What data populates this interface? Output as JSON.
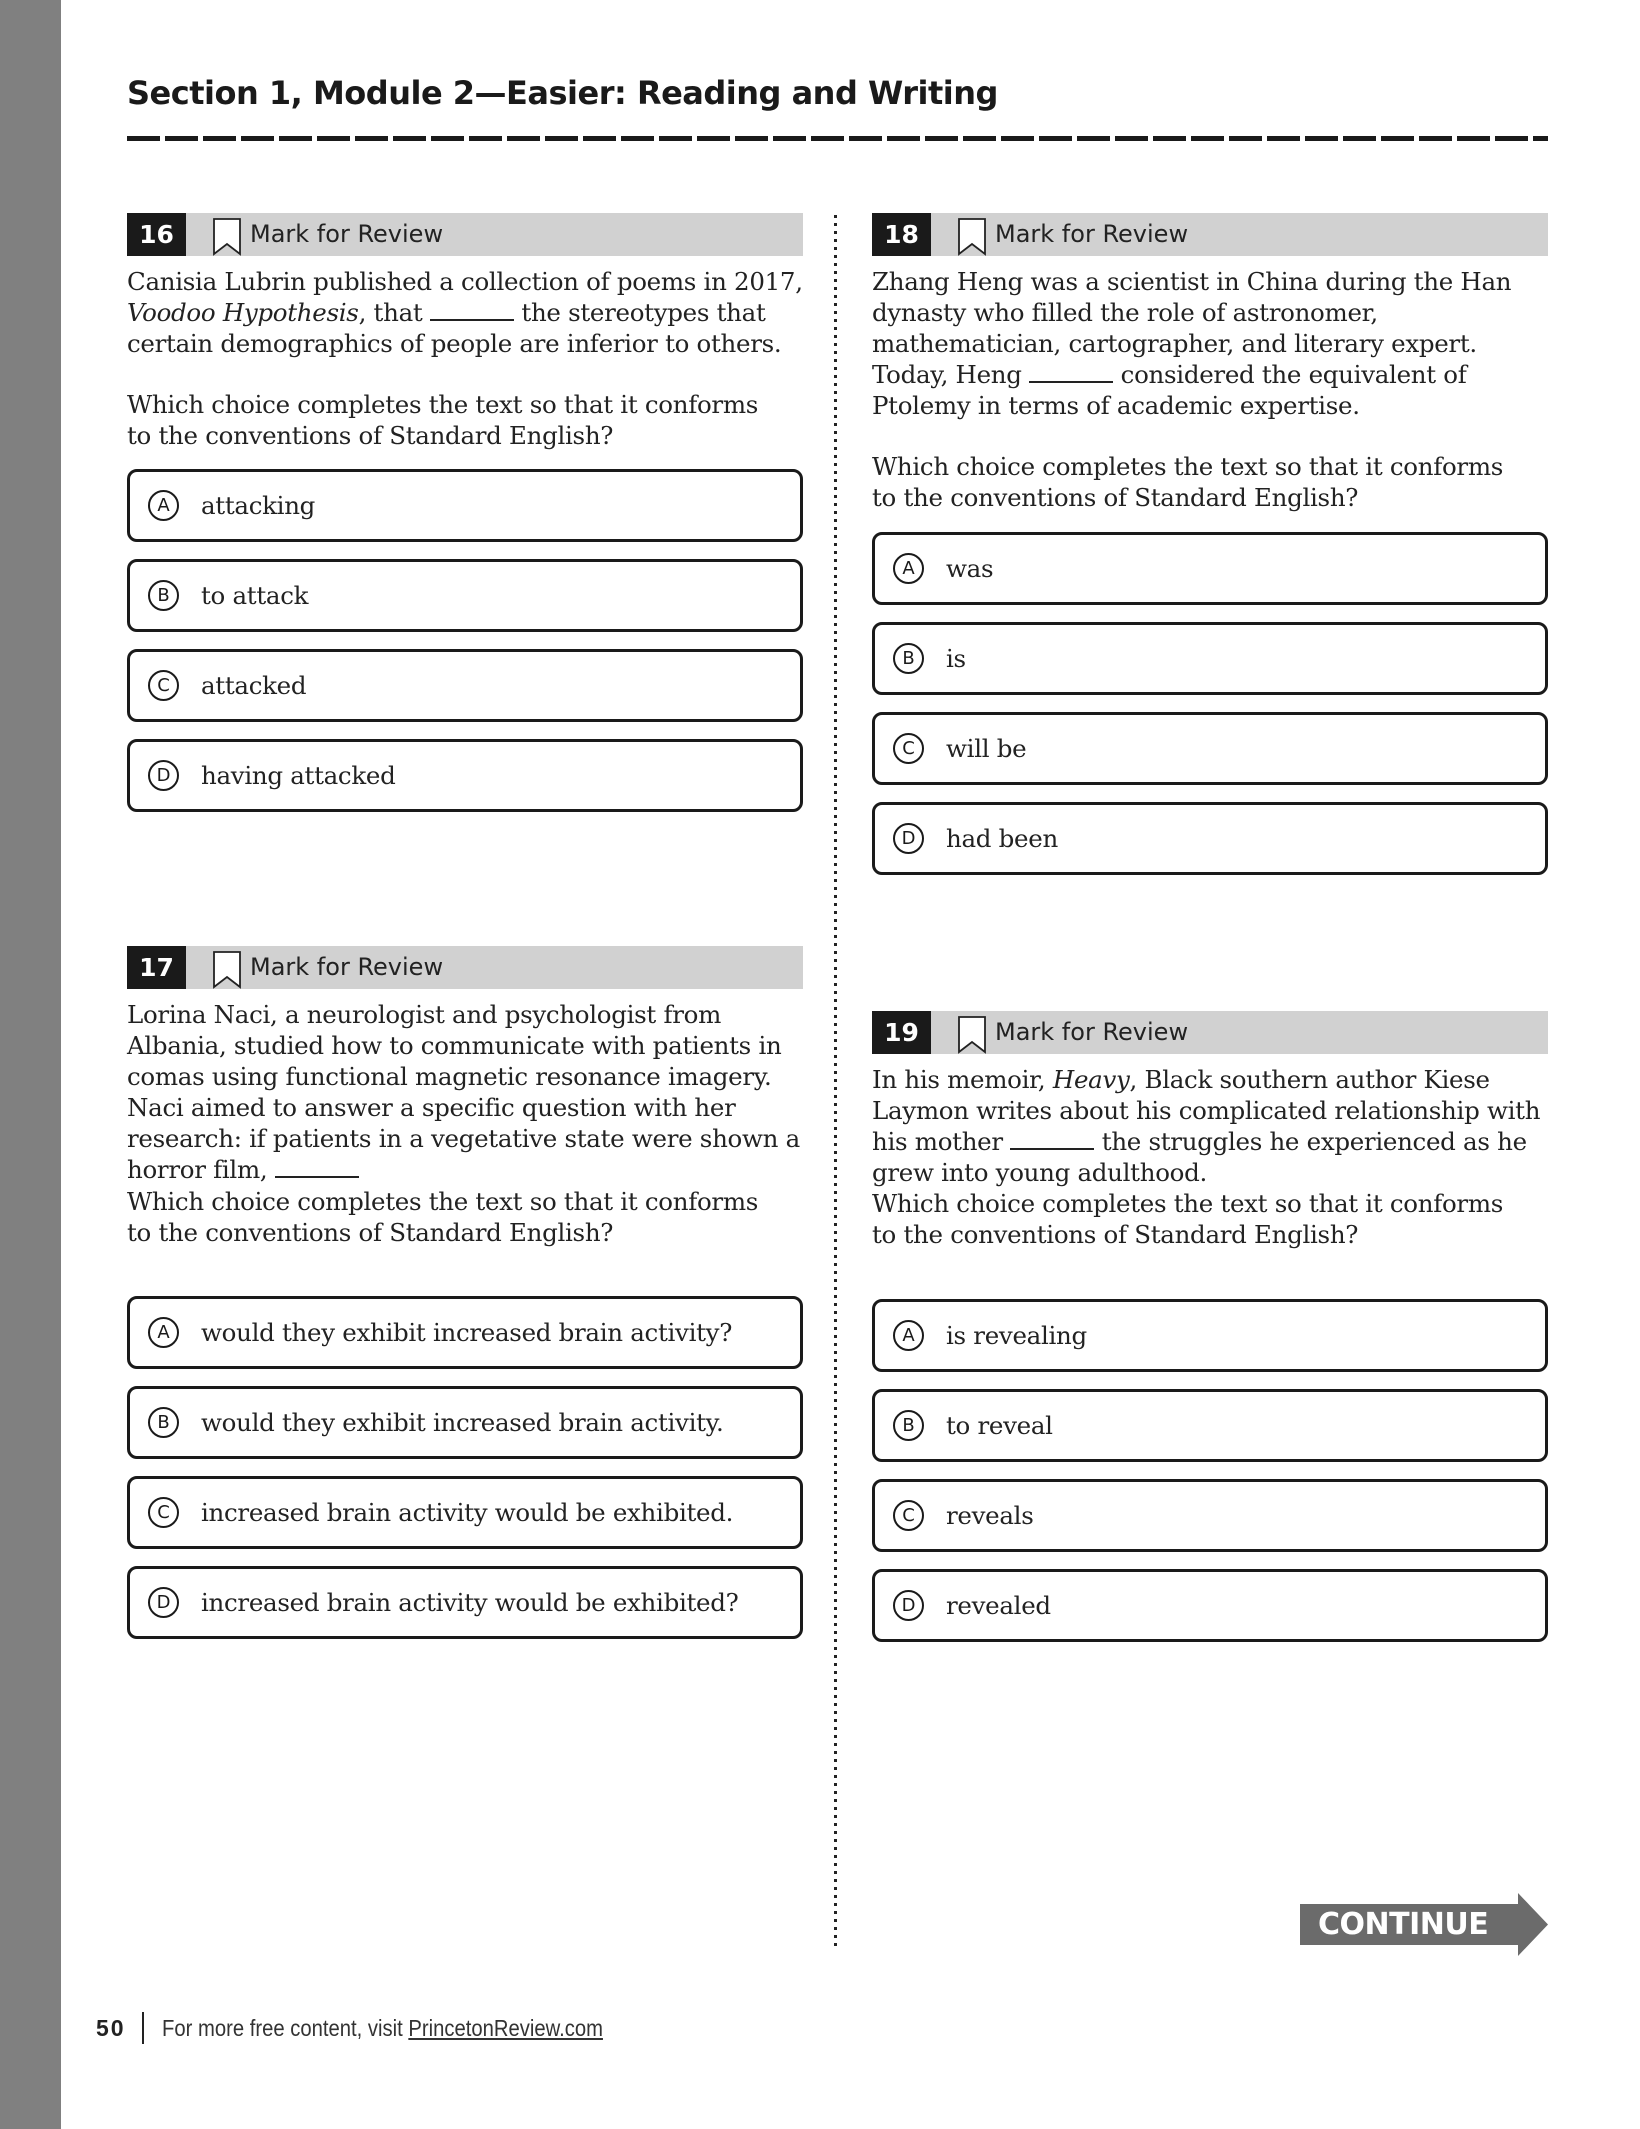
{
  "page": {
    "title": "Section 1, Module 2—Easier: Reading and Writing",
    "page_number": "50",
    "footer_text": "For more free content, visit ",
    "footer_link": "PrincetonReview.com",
    "continue_label": "CONTINUE"
  },
  "mark_label": "Mark for Review",
  "prompt": "Which choice completes the text so that it conforms to the conventions of Standard English?",
  "questions": {
    "q16": {
      "number": "16",
      "passage_parts": [
        "Canisia Lubrin published a collection of poems in 2017, ",
        "Voodoo Hypothesis",
        ", that ",
        " the stereotypes that certain demographics of people are inferior to others."
      ],
      "options": [
        {
          "letter": "A",
          "text": "attacking"
        },
        {
          "letter": "B",
          "text": "to attack"
        },
        {
          "letter": "C",
          "text": "attacked"
        },
        {
          "letter": "D",
          "text": "having attacked"
        }
      ]
    },
    "q17": {
      "number": "17",
      "passage_parts": [
        "Lorina Naci, a neurologist and psychologist from Albania, studied how to communicate with patients in comas using functional magnetic resonance imagery. Naci aimed to answer a specific question with her research: if patients in a vegetative state were shown a horror film, "
      ],
      "options": [
        {
          "letter": "A",
          "text": "would they exhibit increased brain activity?"
        },
        {
          "letter": "B",
          "text": "would they exhibit increased brain activity."
        },
        {
          "letter": "C",
          "text": "increased brain activity would be exhibited."
        },
        {
          "letter": "D",
          "text": "increased brain activity would be exhibited?"
        }
      ]
    },
    "q18": {
      "number": "18",
      "passage_parts": [
        "Zhang Heng was a scientist in China during the Han dynasty who filled the role of astronomer, mathematician, cartographer, and literary expert. Today, Heng ",
        " considered the equivalent of Ptolemy in terms of academic expertise."
      ],
      "options": [
        {
          "letter": "A",
          "text": "was"
        },
        {
          "letter": "B",
          "text": "is"
        },
        {
          "letter": "C",
          "text": "will be"
        },
        {
          "letter": "D",
          "text": "had been"
        }
      ]
    },
    "q19": {
      "number": "19",
      "passage_parts": [
        "In his memoir, ",
        "Heavy",
        ", Black southern author Kiese Laymon writes about his complicated relationship with his mother ",
        " the struggles he experienced as he grew into young adulthood."
      ],
      "options": [
        {
          "letter": "A",
          "text": "is revealing"
        },
        {
          "letter": "B",
          "text": "to reveal"
        },
        {
          "letter": "C",
          "text": "reveals"
        },
        {
          "letter": "D",
          "text": "revealed"
        }
      ]
    }
  }
}
